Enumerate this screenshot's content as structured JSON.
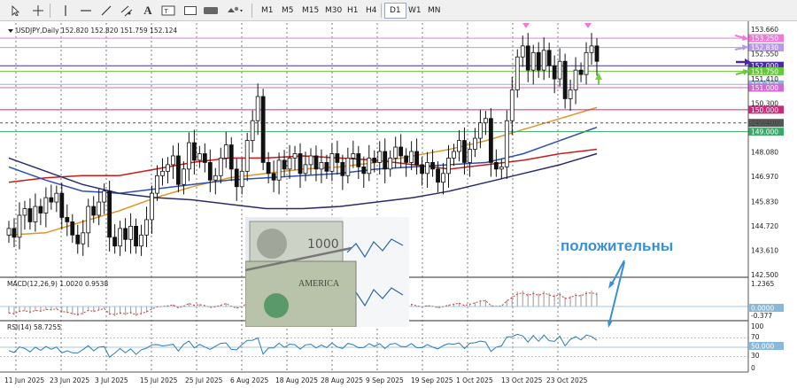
{
  "toolbar": {
    "icons": [
      "cursor-arrow-icon",
      "crosshair-icon",
      "vertical-line-icon",
      "horizontal-line-icon",
      "trendline-icon",
      "channel-icon",
      "text-icon",
      "text-label-icon",
      "rectangle-icon",
      "shapes-menu-icon"
    ],
    "timeframes": [
      "M1",
      "M5",
      "M15",
      "M30",
      "H1",
      "H4",
      "D1",
      "W1",
      "MN"
    ],
    "active_timeframe": "D1"
  },
  "header": {
    "symbol_line": "USDJPY,Daily  152.820 152.820 151.759 152.124"
  },
  "price_axis": {
    "ticks": [
      "153.660",
      "152.550",
      "151.410",
      "150.300",
      "149.400",
      "148.080",
      "146.970",
      "145.830",
      "144.720",
      "143.610",
      "142.500"
    ],
    "badges": [
      {
        "text": "153.250",
        "color": "#f07ad8"
      },
      {
        "text": "152.830",
        "color": "#b89ae8"
      },
      {
        "text": "152.000",
        "color": "#4a2aa8"
      },
      {
        "text": "151.750",
        "color": "#66c83a"
      },
      {
        "text": "151.150",
        "color": "#8ab8d8"
      },
      {
        "text": "151.000",
        "color": "#d26ad2"
      },
      {
        "text": "150.000",
        "color": "#cc2a7a"
      },
      {
        "text": "149.400",
        "color": "#555555"
      },
      {
        "text": "149.000",
        "color": "#3aa86a"
      }
    ]
  },
  "chart_data": {
    "type": "candlestick",
    "symbol": "USDJPY",
    "timeframe": "Daily",
    "ohlc_header": {
      "open": 152.82,
      "high": 152.82,
      "low": 151.759,
      "close": 152.124
    },
    "ylim": [
      142.5,
      153.7
    ],
    "dates": [
      "11 Jun 2025",
      "23 Jun 2025",
      "3 Jul 2025",
      "15 Jul 2025",
      "25 Jul 2025",
      "6 Aug 2025",
      "18 Aug 2025",
      "28 Aug 2025",
      "9 Sep 2025",
      "19 Sep 2025",
      "1 Oct 2025",
      "13 Oct 2025",
      "23 Oct 2025"
    ],
    "close_series": [
      144.6,
      144.2,
      145.2,
      145.5,
      144.9,
      145.6,
      145.3,
      146.0,
      145.8,
      146.2,
      145.1,
      144.9,
      144.3,
      143.9,
      144.4,
      145.6,
      145.2,
      145.8,
      146.3,
      144.2,
      143.8,
      144.6,
      144.1,
      144.7,
      143.8,
      144.3,
      145.0,
      146.2,
      147.0,
      147.2,
      147.5,
      147.9,
      146.6,
      147.3,
      148.5,
      147.7,
      148.0,
      147.6,
      146.8,
      147.0,
      147.8,
      148.4,
      147.3,
      146.5,
      147.2,
      148.6,
      149.5,
      150.6,
      147.6,
      147.1,
      146.8,
      147.7,
      147.3,
      147.8,
      148.0,
      147.1,
      147.5,
      147.9,
      147.3,
      147.6,
      147.2,
      148.0,
      147.6,
      147.0,
      147.8,
      148.0,
      147.4,
      147.1,
      147.8,
      147.6,
      148.1,
      147.3,
      147.8,
      148.3,
      147.9,
      147.6,
      148.1,
      147.5,
      147.1,
      147.6,
      147.3,
      146.7,
      147.1,
      147.8,
      148.1,
      148.6,
      147.6,
      148.2,
      148.7,
      149.4,
      149.6,
      147.6,
      147.3,
      147.4,
      149.5,
      150.9,
      152.4,
      152.9,
      151.8,
      152.6,
      151.8,
      152.7,
      152.0,
      151.4,
      152.2,
      150.5,
      150.9,
      151.8,
      151.6,
      152.6,
      152.9,
      152.2
    ],
    "moving_averages": [
      {
        "color": "#cc1a1a",
        "values": [
          146.7,
          146.9,
          147.0,
          147.0,
          147.3,
          147.6,
          147.8,
          147.8,
          147.9,
          147.8,
          147.7,
          147.5,
          147.3,
          147.5,
          147.7,
          148.0,
          148.2
        ]
      },
      {
        "color": "#e0952a",
        "values": [
          144.3,
          144.4,
          144.9,
          145.4,
          146.0,
          146.5,
          146.9,
          147.1,
          147.3,
          147.4,
          147.6,
          147.9,
          148.2,
          148.6,
          149.1,
          149.6,
          150.1
        ]
      },
      {
        "color": "#2d4fb5",
        "values": [
          147.4,
          146.8,
          146.3,
          146.2,
          146.4,
          146.6,
          146.8,
          146.9,
          147.0,
          147.1,
          147.3,
          147.4,
          147.5,
          147.6,
          148.0,
          148.6,
          149.2
        ]
      },
      {
        "color": "#2a2a6e",
        "values": [
          147.8,
          147.2,
          146.6,
          146.2,
          146.0,
          145.9,
          145.7,
          145.5,
          145.5,
          145.6,
          145.8,
          146.0,
          146.3,
          146.7,
          147.1,
          147.5,
          148.0
        ]
      }
    ],
    "horizontal_levels": [
      {
        "value": 153.25,
        "color": "#f07ad8"
      },
      {
        "value": 152.83,
        "color": "#b89ae8"
      },
      {
        "value": 152.0,
        "color": "#4a2aa8"
      },
      {
        "value": 151.75,
        "color": "#66c83a"
      },
      {
        "value": 151.15,
        "color": "#8ab8d8"
      },
      {
        "value": 151.0,
        "color": "#d26ad2"
      },
      {
        "value": 150.0,
        "color": "#cc2a7a"
      },
      {
        "value": 149.4,
        "color": "#555555"
      },
      {
        "value": 149.0,
        "color": "#3aa86a"
      }
    ]
  },
  "macd": {
    "label": "MACD(12,26,9) 1.0020 0.9538",
    "ticks": [
      "1.2365",
      "0.0000",
      "-0.377"
    ],
    "zero_badge": "0.0000"
  },
  "rsi": {
    "label": "RSI(14) 58.7255",
    "ticks": [
      "100",
      "70",
      "50",
      "30",
      "0"
    ],
    "badge": "50.000"
  },
  "overlay": {
    "word": "положительны"
  }
}
